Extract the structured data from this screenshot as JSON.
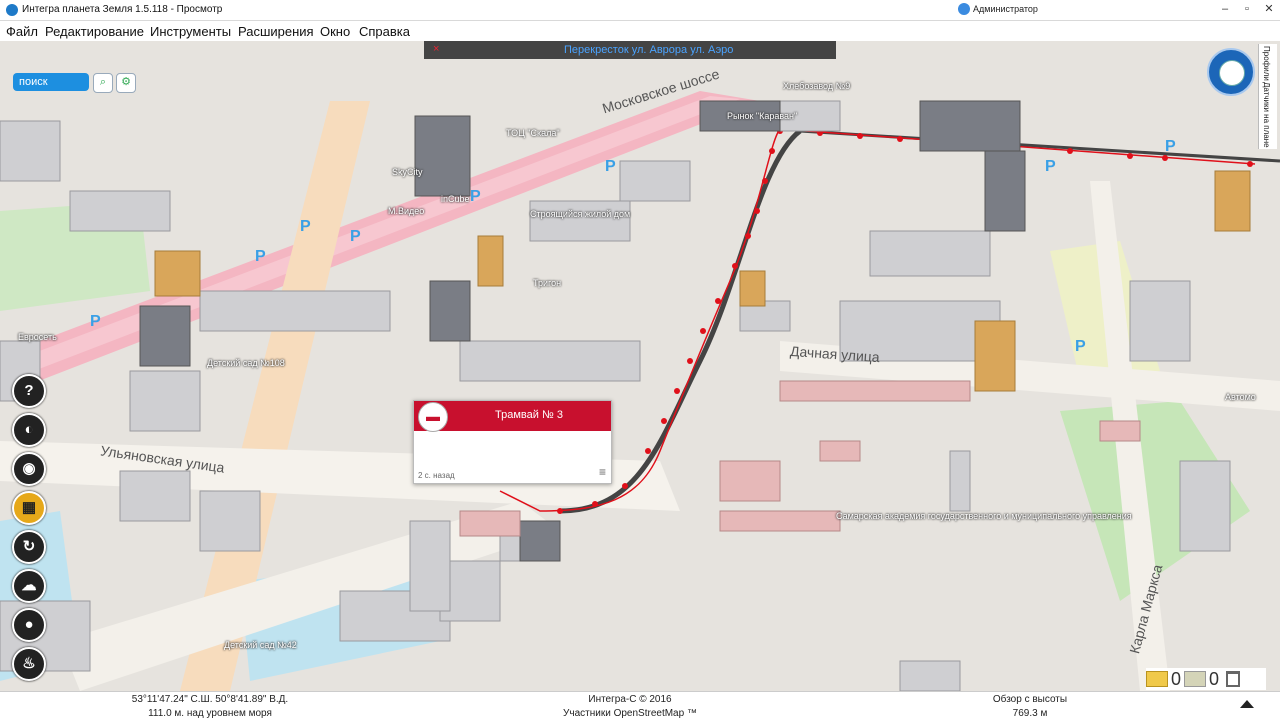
{
  "window": {
    "title": "Интегра планета Земля 1.5.118 - Просмотр",
    "user": "Администратор",
    "controls": [
      "–",
      "▫",
      "✕"
    ]
  },
  "menu": [
    "Файл",
    "Редактирование",
    "Инструменты",
    "Расширения",
    "Окно",
    "Справка"
  ],
  "top_banner": {
    "text": "Перекресток ул. Аврора ул. Аэро",
    "close": "×"
  },
  "search": {
    "placeholder": "поиск",
    "zoom_icon": "magnifier-icon",
    "settings_icon": "gear-icon"
  },
  "right_tabs": [
    "Профили",
    "Датчики на плане"
  ],
  "toolbar": [
    {
      "name": "help",
      "glyph": "?",
      "active": false
    },
    {
      "name": "camera",
      "glyph": "◐",
      "active": false
    },
    {
      "name": "photo",
      "glyph": "◉",
      "active": false
    },
    {
      "name": "buildings",
      "glyph": "▦",
      "active": true
    },
    {
      "name": "route",
      "glyph": "↻",
      "active": false
    },
    {
      "name": "weather",
      "glyph": "☁",
      "active": false
    },
    {
      "name": "bomb",
      "glyph": "●",
      "active": false
    },
    {
      "name": "alarm",
      "glyph": "♨",
      "active": false
    }
  ],
  "map_labels": [
    "Рынок \"Караван\"",
    "Хлебозавод №9",
    "ТОЦ \"Скала\"",
    "SkyCity",
    "М.Видео",
    "inCube",
    "Строящийся жилой дом",
    "Тригон",
    "Евросеть",
    "Детский сад №108",
    "Детский сад №42",
    "Самарская академия государственного и муниципального управления",
    "Автомо"
  ],
  "street_labels": [
    "Московское шоссе",
    "Дачная улица",
    "Ульяновская улица",
    "Карла Маркса"
  ],
  "popup": {
    "title": "Трамвай № 3",
    "time": "2 с. назад",
    "menu": "≡"
  },
  "status": {
    "coords": "53°11'47.24\" С.Ш. 50°8'41.89\" В.Д.",
    "elevation": "111.0 м. над уровнем моря",
    "copyright": "Интегра-С © 2016",
    "osm": "Участники OpenStreetMap ™",
    "view_label": "Обзор с высоты",
    "view_height": "769.3 м",
    "msg_count_1": "0",
    "msg_count_2": "0"
  }
}
